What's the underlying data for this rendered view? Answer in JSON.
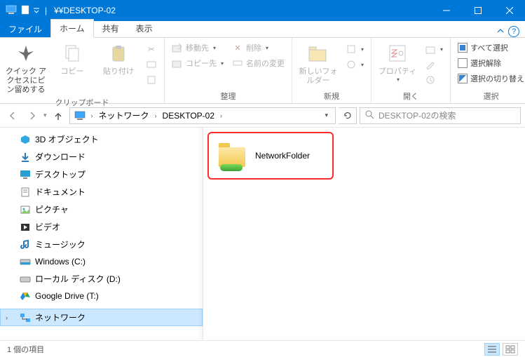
{
  "window": {
    "title": "¥¥DESKTOP-02"
  },
  "tabs": {
    "file": "ファイル",
    "home": "ホーム",
    "share": "共有",
    "view": "表示"
  },
  "ribbon": {
    "clipboard": {
      "pin": "クイック アクセスにピン留めする",
      "copy": "コピー",
      "paste": "貼り付け",
      "label": "クリップボード"
    },
    "organize": {
      "moveTo": "移動先",
      "delete": "削除",
      "copyTo": "コピー先",
      "rename": "名前の変更",
      "label": "整理"
    },
    "new": {
      "newFolder": "新しいフォルダー",
      "label": "新規"
    },
    "open": {
      "properties": "プロパティ",
      "label": "開く"
    },
    "select": {
      "selectAll": "すべて選択",
      "selectNone": "選択解除",
      "invert": "選択の切り替え",
      "label": "選択"
    }
  },
  "address": {
    "network": "ネットワーク",
    "host": "DESKTOP-02"
  },
  "search": {
    "placeholder": "DESKTOP-02の検索"
  },
  "sidebar": {
    "items": [
      {
        "label": "3D オブジェクト",
        "icon": "3d"
      },
      {
        "label": "ダウンロード",
        "icon": "down"
      },
      {
        "label": "デスクトップ",
        "icon": "desk"
      },
      {
        "label": "ドキュメント",
        "icon": "doc"
      },
      {
        "label": "ピクチャ",
        "icon": "pic"
      },
      {
        "label": "ビデオ",
        "icon": "vid"
      },
      {
        "label": "ミュージック",
        "icon": "mus"
      },
      {
        "label": "Windows (C:)",
        "icon": "drv"
      },
      {
        "label": "ローカル ディスク (D:)",
        "icon": "drv"
      },
      {
        "label": "Google Drive (T:)",
        "icon": "gd"
      }
    ],
    "network": "ネットワーク"
  },
  "content": {
    "items": [
      {
        "name": "NetworkFolder"
      }
    ]
  },
  "status": {
    "count": "1 個の項目"
  }
}
